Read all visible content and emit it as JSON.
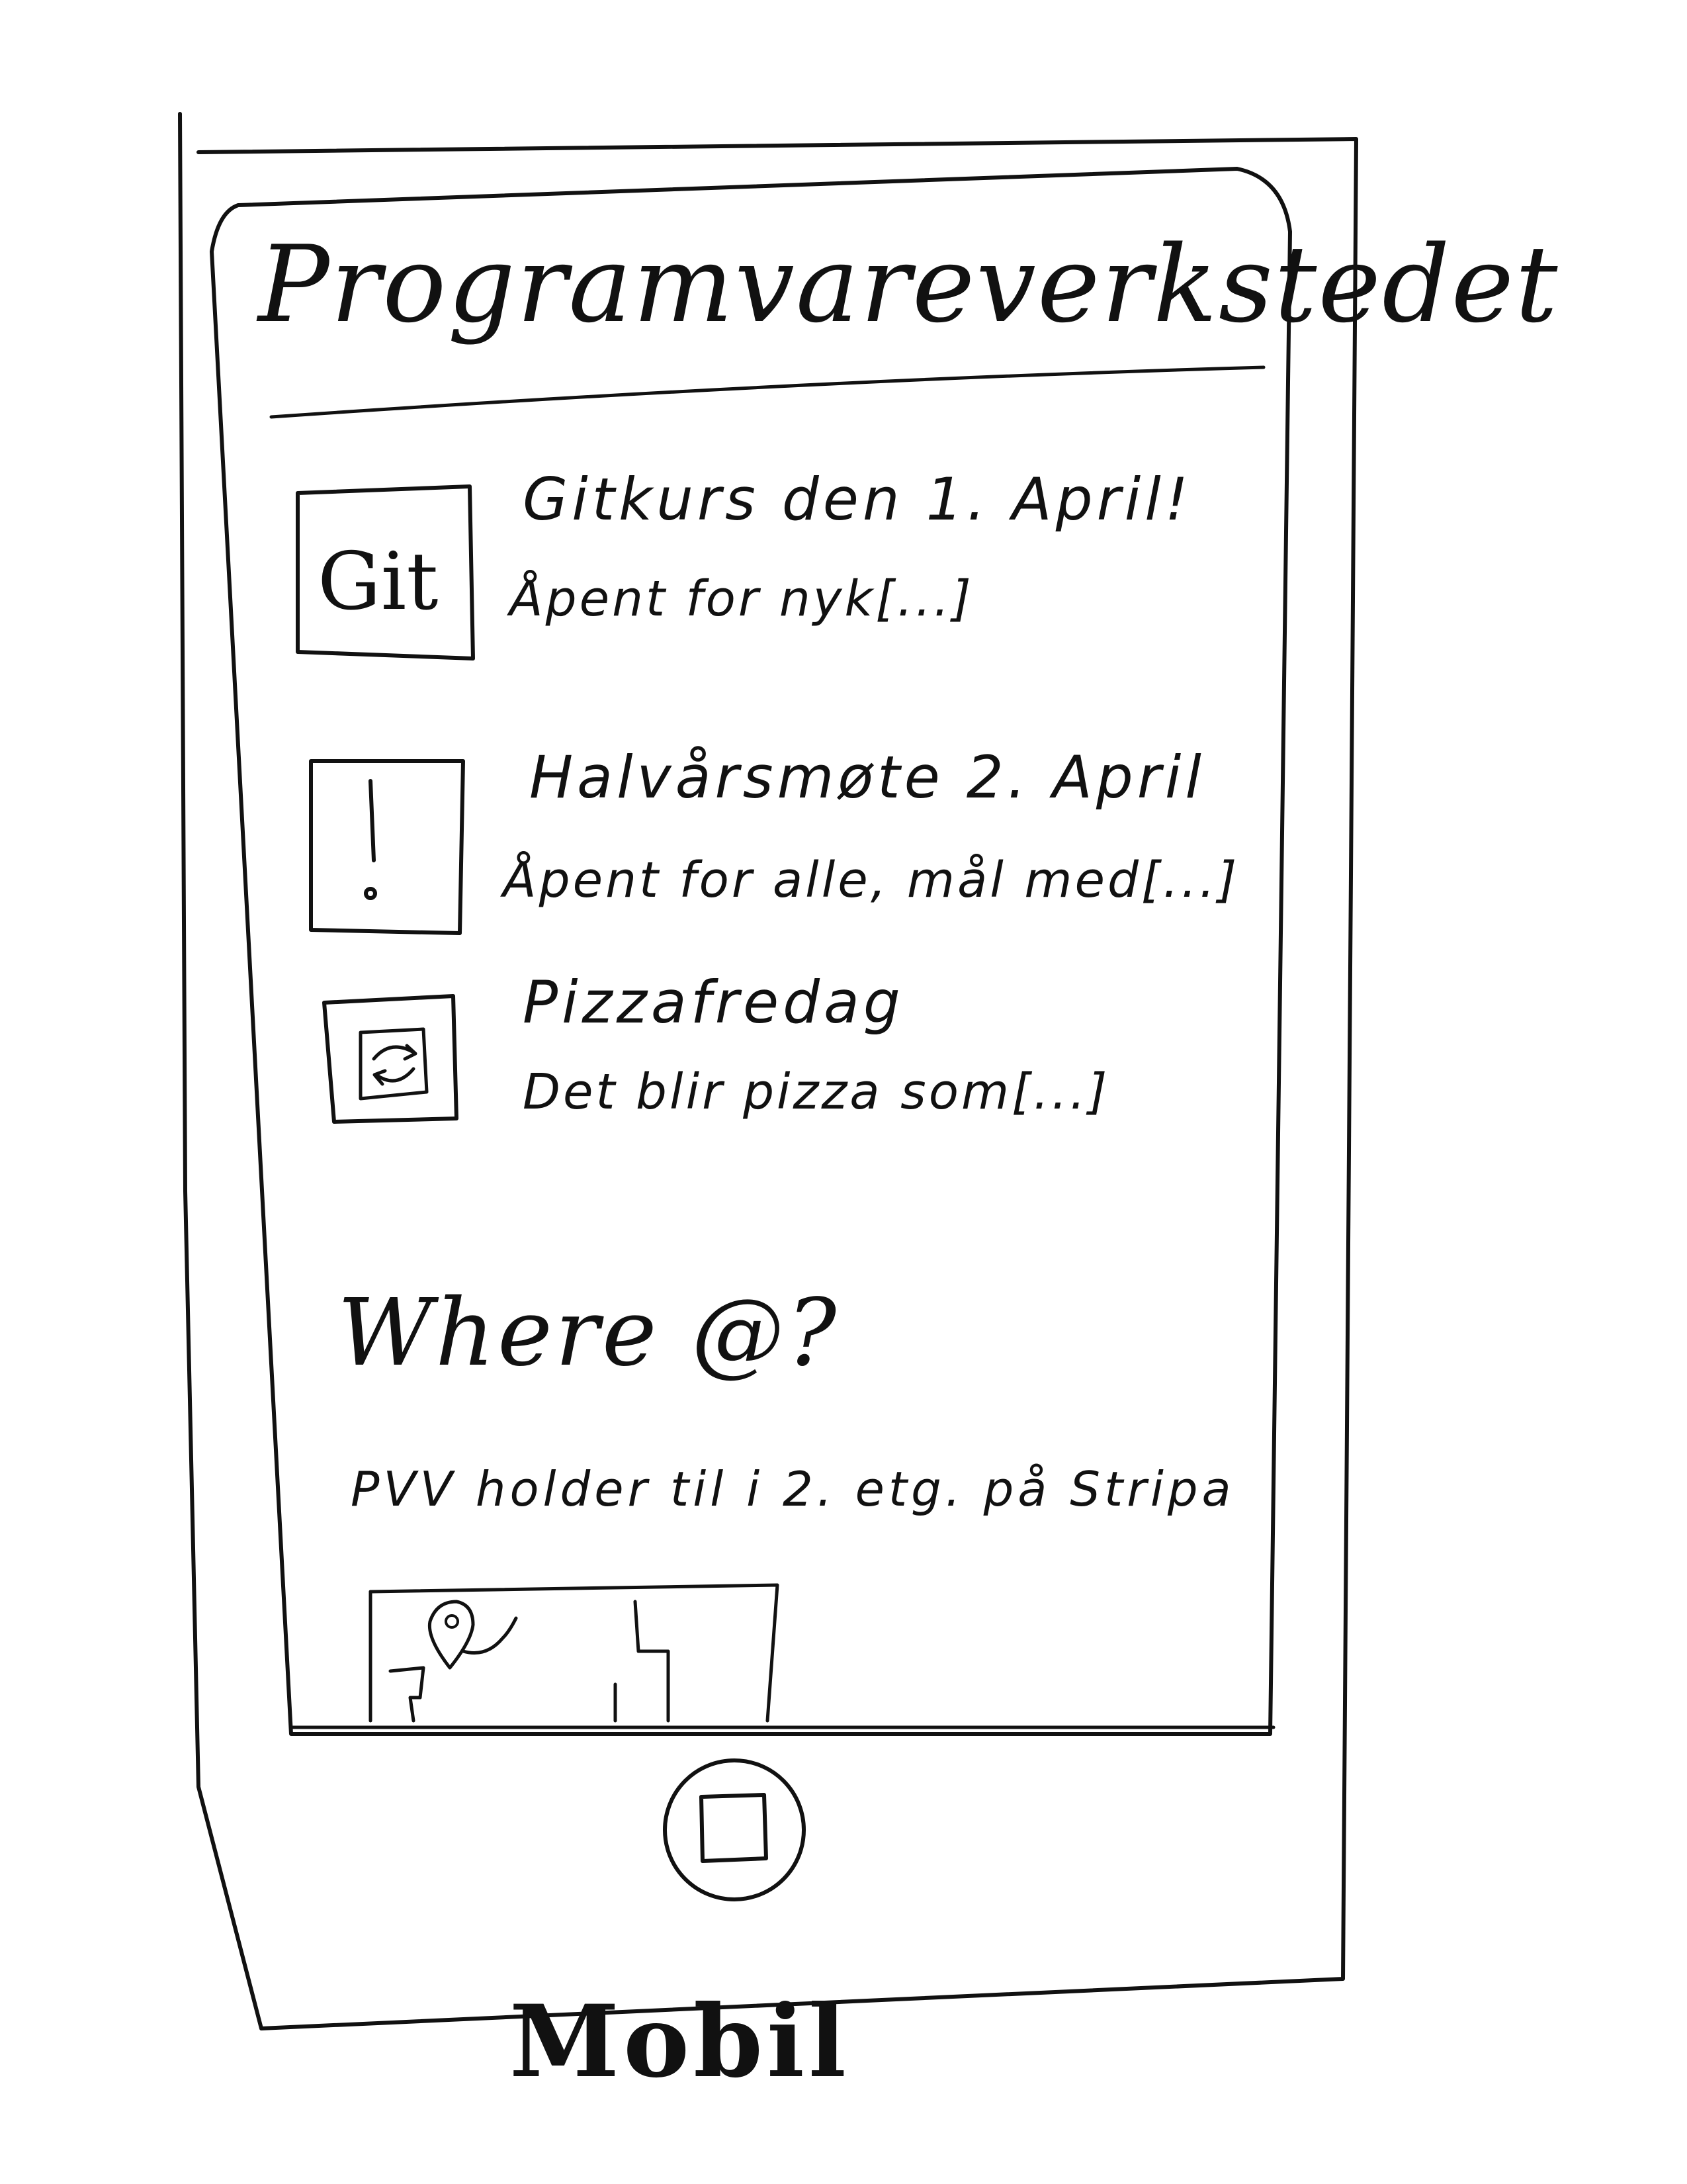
{
  "app": {
    "title": "Programvareverkstedet"
  },
  "news": [
    {
      "icon": "git-icon",
      "icon_label": "Git",
      "title": "Gitkurs den 1. April!",
      "description": "Åpent for nyk[...]"
    },
    {
      "icon": "exclamation-icon",
      "title": "Halvårsmøte 2. April",
      "description": "Åpent for alle, mål med[...]"
    },
    {
      "icon": "refresh-icon",
      "title": "Pizzafredag",
      "description": "Det blir pizza som[...]"
    }
  ],
  "location": {
    "title": "Where @?",
    "description": "PVV holder til i 2. etg. på Stripa",
    "map_icon": "map-pin-icon"
  },
  "device": {
    "home_button_icon": "home-button-icon",
    "caption": "Mobil"
  }
}
